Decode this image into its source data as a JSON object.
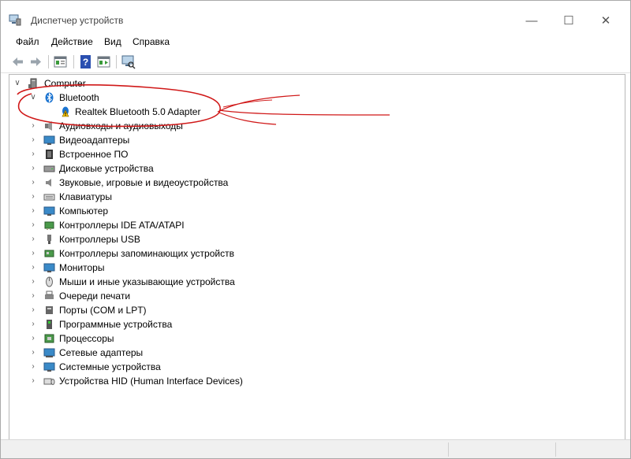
{
  "window": {
    "title": "Диспетчер устройств",
    "buttons": {
      "minimize": "—",
      "maximize": "☐",
      "close": "✕"
    }
  },
  "menu": [
    "Файл",
    "Действие",
    "Вид",
    "Справка"
  ],
  "toolbar": [
    "back-icon",
    "forward-icon",
    "properties-icon",
    "help-icon",
    "update-driver-icon",
    "scan-hardware-icon"
  ],
  "tree": {
    "root": "Computer",
    "expanded_category": "Bluetooth",
    "expanded_child": "Realtek Bluetooth 5.0 Adapter",
    "categories": [
      "Аудиовходы и аудиовыходы",
      "Видеоадаптеры",
      "Встроенное ПО",
      "Дисковые устройства",
      "Звуковые, игровые и видеоустройства",
      "Клавиатуры",
      "Компьютер",
      "Контроллеры IDE ATA/ATAPI",
      "Контроллеры USB",
      "Контроллеры запоминающих устройств",
      "Мониторы",
      "Мыши и иные указывающие устройства",
      "Очереди печати",
      "Порты (COM и LPT)",
      "Программные устройства",
      "Процессоры",
      "Сетевые адаптеры",
      "Системные устройства",
      "Устройства HID (Human Interface Devices)"
    ]
  },
  "colors": {
    "annotation": "#d01818",
    "bluetooth": "#1a73d0",
    "warning": "#f5c400"
  }
}
